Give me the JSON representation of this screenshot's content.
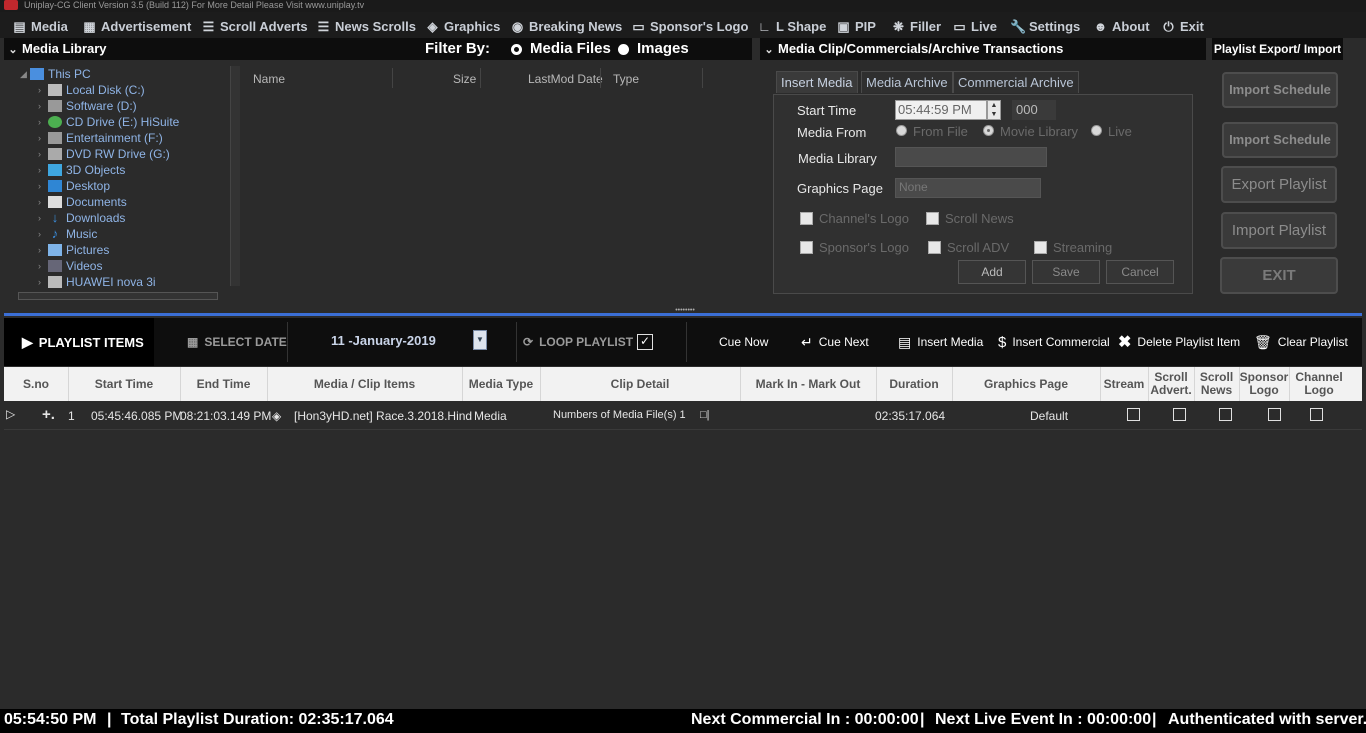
{
  "titlebar": {
    "text": "Uniplay-CG Client Version 3.5 (Build 112) For More Detail Please Visit www.uniplay.tv"
  },
  "menu": [
    {
      "label": "Media",
      "icon": "media-icon"
    },
    {
      "label": "Advertisement",
      "icon": "calendar-icon"
    },
    {
      "label": "Scroll Adverts",
      "icon": "scroll-icon"
    },
    {
      "label": "News Scrolls",
      "icon": "list-icon"
    },
    {
      "label": "Graphics",
      "icon": "layers-icon"
    },
    {
      "label": "Breaking News",
      "icon": "globe-icon"
    },
    {
      "label": "Sponsor's Logo",
      "icon": "monitor-icon"
    },
    {
      "label": "L Shape",
      "icon": "l-shape-icon"
    },
    {
      "label": "PIP",
      "icon": "pip-icon"
    },
    {
      "label": "Filler",
      "icon": "spinner-icon"
    },
    {
      "label": "Live",
      "icon": "screen-icon"
    },
    {
      "label": "Settings",
      "icon": "wrench-icon"
    },
    {
      "label": "About",
      "icon": "user-icon"
    },
    {
      "label": "Exit",
      "icon": "power-icon"
    }
  ],
  "media_library": {
    "title": "Media Library",
    "filter_label": "Filter By:",
    "filter_options": [
      "Media Files",
      "Images"
    ],
    "tree": [
      "This PC",
      "Local Disk (C:)",
      "Software (D:)",
      "CD Drive (E:) HiSuite",
      "Entertainment (F:)",
      "DVD RW Drive (G:)",
      "3D Objects",
      "Desktop",
      "Documents",
      "Downloads",
      "Music",
      "Pictures",
      "Videos",
      "HUAWEI nova 3i"
    ],
    "columns": [
      "Name",
      "Size",
      "LastMod Date",
      "Type"
    ]
  },
  "clip_panel": {
    "title": "Media Clip/Commercials/Archive Transactions",
    "tabs": [
      "Insert Media",
      "Media Archive",
      "Commercial Archive"
    ],
    "start_time_label": "Start Time",
    "start_time_value": "05:44:59 PM",
    "start_ms_value": "000",
    "media_from_label": "Media From",
    "media_from_options": [
      "From File",
      "Movie Library",
      "Live"
    ],
    "media_library_label": "Media Library",
    "graphics_page_label": "Graphics Page",
    "graphics_page_value": "None",
    "checkboxes": [
      "Channel's Logo",
      "Scroll News",
      "Sponsor's Logo",
      "Scroll ADV",
      "Streaming"
    ],
    "buttons": [
      "Add",
      "Save",
      "Cancel"
    ]
  },
  "export_panel": {
    "title": "Playlist Export/ Import",
    "buttons": [
      "Import Schedule",
      "Import Schedule",
      "Export Playlist",
      "Import Playlist",
      "EXIT"
    ]
  },
  "playlist_bar": {
    "title": "PLAYLIST ITEMS",
    "select_date": "SELECT DATE",
    "date_value": "11 -January-2019",
    "loop_playlist": "LOOP PLAYLIST",
    "cue_now": "Cue Now",
    "cue_next": "Cue Next",
    "insert_media": "Insert Media",
    "insert_commercial": "Insert Commercial",
    "delete_item": "Delete Playlist Item",
    "clear_playlist": "Clear Playlist"
  },
  "grid": {
    "headers": [
      "S.no",
      "Start Time",
      "End Time",
      "Media / Clip Items",
      "Media Type",
      "Clip Detail",
      "Mark In - Mark Out",
      "Duration",
      "Graphics Page",
      "Stream",
      "Scroll Advert.",
      "Scroll News",
      "Sponsor Logo",
      "Channel Logo"
    ],
    "rows": [
      {
        "sno": "1",
        "start": "05:45:46.085 PM",
        "end": "08:21:03.149 PM",
        "item": "[Hon3yHD.net] Race.3.2018.Hind",
        "type": "Media",
        "detail": "Numbers of Media File(s) 1",
        "mark": "",
        "duration": "02:35:17.064",
        "graphics": "Default"
      }
    ]
  },
  "status": {
    "clock": "05:54:50 PM",
    "total_duration": "Total Playlist Duration: 02:35:17.064",
    "next_commercial": "Next Commercial In : 00:00:00",
    "next_live": "Next Live Event In : 00:00:00",
    "auth": "Authenticated with server."
  },
  "colors": {
    "accent": "#3b6fd6",
    "background": "#2b2b2b",
    "header_bg": "#0d0d0d"
  }
}
